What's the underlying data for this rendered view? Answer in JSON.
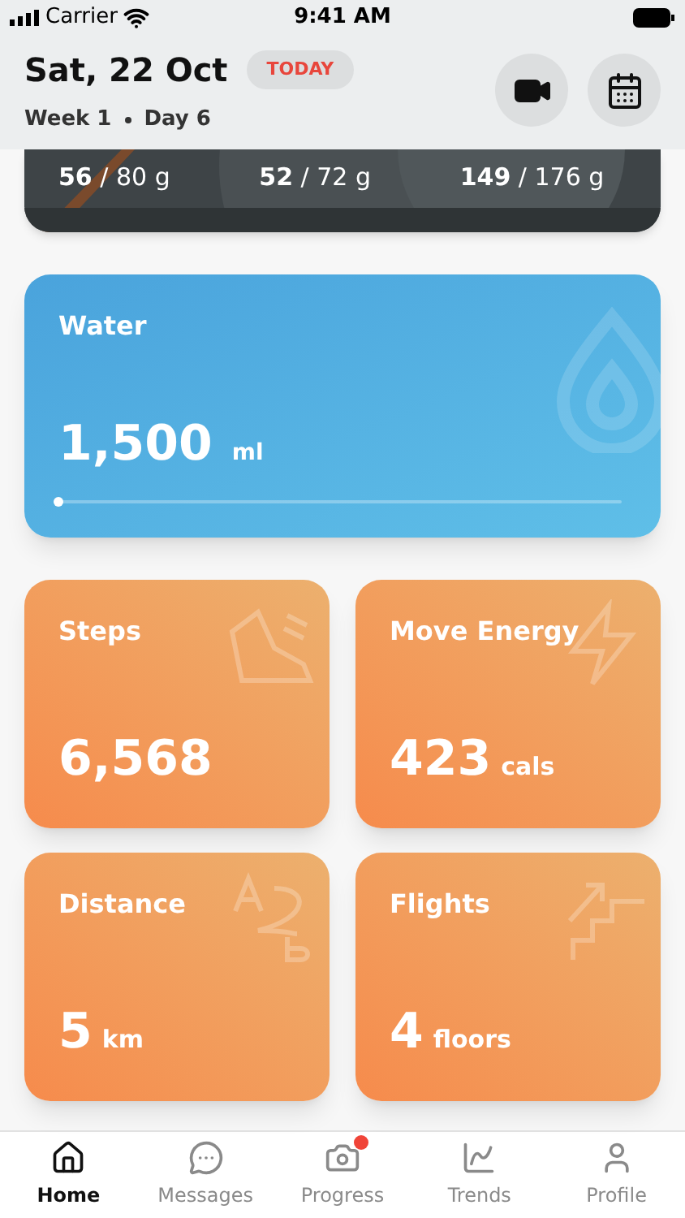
{
  "status_bar": {
    "carrier": "Carrier",
    "time": "9:41 AM"
  },
  "header": {
    "date": "Sat, 22 Oct",
    "badge": "TODAY",
    "week": "Week 1",
    "day": "Day 6"
  },
  "macros": [
    {
      "value": "**56** / 80 g"
    },
    {
      "value": "**52** / 72 g"
    },
    {
      "value": "**149** / 176 g"
    }
  ],
  "water": {
    "title": "Water",
    "value": "1,500",
    "unit": "ml",
    "level": 0
  },
  "tiles": [
    {
      "kind": "steps",
      "title": "Steps",
      "value": "6,568"
    },
    {
      "kind": "energy",
      "title": "Move Energy",
      "value": "423",
      "unit": "cals"
    },
    {
      "kind": "distance",
      "title": "Distance",
      "value": "5",
      "unit": "km"
    },
    {
      "kind": "flights",
      "title": "Flights",
      "value": "4",
      "unit": "floors"
    }
  ],
  "tab_bar": [
    {
      "kind": "home",
      "label": "Home",
      "selected": true,
      "badge": false
    },
    {
      "kind": "messages",
      "label": "Messages",
      "selected": false,
      "badge": false
    },
    {
      "kind": "progress",
      "label": "Progress",
      "selected": false,
      "badge": true
    },
    {
      "kind": "trends",
      "label": "Trends",
      "selected": false,
      "badge": false
    },
    {
      "kind": "profile",
      "label": "Profile",
      "selected": false,
      "badge": false
    }
  ]
}
